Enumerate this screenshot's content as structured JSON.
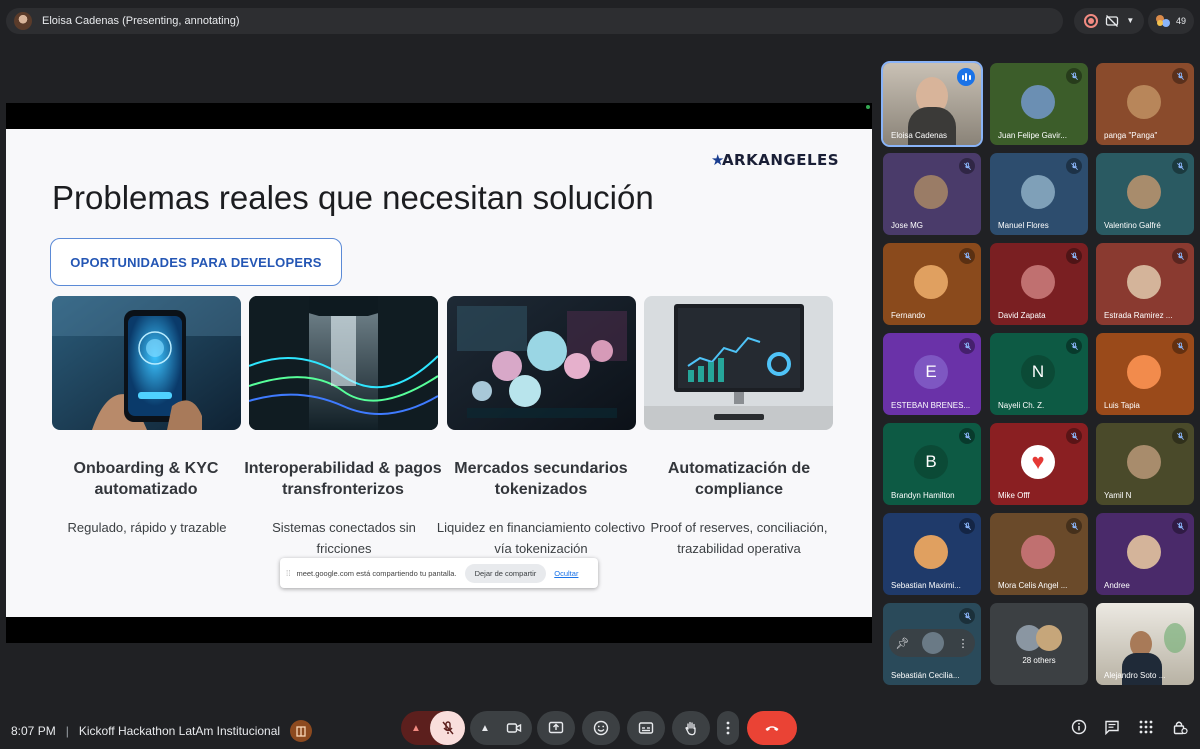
{
  "top_bar": {
    "presenter_label": "Eloisa Cadenas (Presenting, annotating)",
    "participant_count": "49"
  },
  "slide": {
    "brand": "ARKANGELES",
    "title": "Problemas reales que necesitan solución",
    "badge": "OPORTUNIDADES PARA DEVELOPERS",
    "cards": [
      {
        "title": "Onboarding & KYC automatizado",
        "desc": "Regulado, rápido y trazable"
      },
      {
        "title": "Interoperabilidad & pagos transfronterizos",
        "desc": "Sistemas conectados sin fricciones"
      },
      {
        "title": "Mercados secundarios tokenizados",
        "desc": "Liquidez en financiamiento colectivo vía tokenización"
      },
      {
        "title": "Automatización de compliance",
        "desc": "Proof of reserves, conciliación, trazabilidad operativa"
      }
    ]
  },
  "share_notice": {
    "text": "meet.google.com está compartiendo tu pantalla.",
    "stop": "Dejar de compartir",
    "hide": "Ocultar"
  },
  "participants": [
    {
      "name": "Eloisa Cadenas",
      "speaking": true,
      "bg": "#6e6a62"
    },
    {
      "name": "Juan Felipe Gavir...",
      "bg": "#3c5d2a"
    },
    {
      "name": "panga \"Panga\"",
      "bg": "#8a4b2c"
    },
    {
      "name": "Jose MG",
      "bg": "#4a3b6a"
    },
    {
      "name": "Manuel Flores",
      "bg": "#2d4d6e"
    },
    {
      "name": "Valentino Galfré",
      "bg": "#2a5a62"
    },
    {
      "name": "Fernando",
      "bg": "#8a4a1c"
    },
    {
      "name": "David Zapata",
      "bg": "#7a1f22"
    },
    {
      "name": "Estrada Ramirez ...",
      "bg": "#8a3a30"
    },
    {
      "name": "ESTEBAN BRENES...",
      "initial": "E",
      "bg": "#6a32a8"
    },
    {
      "name": "Nayeli Ch. Z.",
      "initial": "N",
      "bg": "#0d5a44"
    },
    {
      "name": "Luis Tapia",
      "bg": "#9a4a1a"
    },
    {
      "name": "Brandyn Hamilton",
      "initial": "B",
      "bg": "#0d5a44"
    },
    {
      "name": "Mike Offf",
      "bg": "#8a1f22"
    },
    {
      "name": "Yamil N",
      "bg": "#4a4a2a"
    },
    {
      "name": "Sebastian Maximi...",
      "bg": "#1f3a6a"
    },
    {
      "name": "Mora Celis Angel ...",
      "bg": "#6a4a2a"
    },
    {
      "name": "Andree",
      "bg": "#4a2a6a"
    },
    {
      "name": "Sebastián Cecilia...",
      "bg": "#2a4a5a"
    },
    {
      "name": "28 others",
      "bg": "#3c4043"
    },
    {
      "name": "Alejandro Soto ...",
      "bg": "#5a5a52"
    }
  ],
  "bottom": {
    "time": "8:07 PM",
    "meeting_title": "Kickoff Hackathon LatAm Institucional"
  },
  "colors": {
    "background": "#202124",
    "accent_blue": "#8ab4f8",
    "end_call_red": "#ea4335",
    "muted_red": "#f28b82"
  },
  "icons": [
    "record-icon",
    "captions-off-icon",
    "people-icon",
    "mic-off-icon",
    "camera-icon",
    "present-icon",
    "emoji-icon",
    "captions-icon",
    "raise-hand-icon",
    "more-options-icon",
    "end-call-icon",
    "info-icon",
    "chat-icon",
    "activities-icon",
    "host-controls-icon"
  ]
}
